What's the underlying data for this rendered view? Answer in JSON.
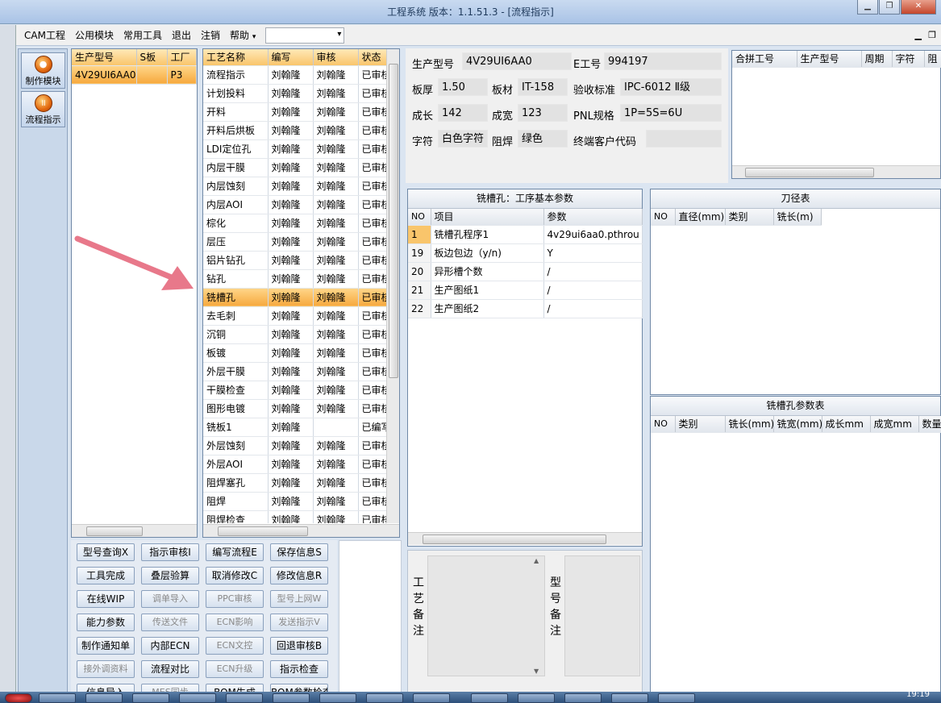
{
  "window": {
    "title": "工程系统    版本：1.1.51.3 - [流程指示]",
    "min": "▁",
    "max": "❐",
    "close": "✕"
  },
  "menu": {
    "items": [
      "CAM工程",
      "公用模块",
      "常用工具",
      "退出",
      "注销",
      "帮助"
    ],
    "help_arrow": "▾",
    "combo_value": "",
    "mdi_min": "▁",
    "mdi_restore": "❐"
  },
  "nav": {
    "items": [
      {
        "label": "制作模块",
        "icon": "flame-icon"
      },
      {
        "label": "流程指示",
        "icon": "pause-icon"
      }
    ]
  },
  "model_list": {
    "headers": [
      "生产型号",
      "S板",
      "工厂"
    ],
    "rows": [
      [
        "4V29UI6AA0",
        "",
        "P3"
      ]
    ]
  },
  "process_list": {
    "headers": [
      "工艺名称",
      "编写",
      "审核",
      "状态"
    ],
    "rows": [
      [
        "流程指示",
        "刘翰隆",
        "刘翰隆",
        "已审核"
      ],
      [
        "计划投料",
        "刘翰隆",
        "刘翰隆",
        "已审核"
      ],
      [
        "开料",
        "刘翰隆",
        "刘翰隆",
        "已审核"
      ],
      [
        "开料后烘板",
        "刘翰隆",
        "刘翰隆",
        "已审核"
      ],
      [
        "LDI定位孔",
        "刘翰隆",
        "刘翰隆",
        "已审核"
      ],
      [
        "内层干膜",
        "刘翰隆",
        "刘翰隆",
        "已审核"
      ],
      [
        "内层蚀刻",
        "刘翰隆",
        "刘翰隆",
        "已审核"
      ],
      [
        "内层AOI",
        "刘翰隆",
        "刘翰隆",
        "已审核"
      ],
      [
        "棕化",
        "刘翰隆",
        "刘翰隆",
        "已审核"
      ],
      [
        "层压",
        "刘翰隆",
        "刘翰隆",
        "已审核"
      ],
      [
        "铝片钻孔",
        "刘翰隆",
        "刘翰隆",
        "已审核"
      ],
      [
        "钻孔",
        "刘翰隆",
        "刘翰隆",
        "已审核"
      ],
      [
        "铣槽孔",
        "刘翰隆",
        "刘翰隆",
        "已审核"
      ],
      [
        "去毛刺",
        "刘翰隆",
        "刘翰隆",
        "已审核"
      ],
      [
        "沉铜",
        "刘翰隆",
        "刘翰隆",
        "已审核"
      ],
      [
        "板镀",
        "刘翰隆",
        "刘翰隆",
        "已审核"
      ],
      [
        "外层干膜",
        "刘翰隆",
        "刘翰隆",
        "已审核"
      ],
      [
        "干膜检查",
        "刘翰隆",
        "刘翰隆",
        "已审核"
      ],
      [
        "图形电镀",
        "刘翰隆",
        "刘翰隆",
        "已审核"
      ],
      [
        "铣板1",
        "刘翰隆",
        "",
        "已编写"
      ],
      [
        "外层蚀刻",
        "刘翰隆",
        "刘翰隆",
        "已审核"
      ],
      [
        "外层AOI",
        "刘翰隆",
        "刘翰隆",
        "已审核"
      ],
      [
        "阻焊塞孔",
        "刘翰隆",
        "刘翰隆",
        "已审核"
      ],
      [
        "阻焊",
        "刘翰隆",
        "刘翰隆",
        "已审核"
      ],
      [
        "阻焊检查",
        "刘翰隆",
        "刘翰隆",
        "已审核"
      ]
    ],
    "selected_index": 12
  },
  "buttons": [
    [
      "型号查询X",
      "指示审核I",
      "编写流程E",
      "保存信息S"
    ],
    [
      "工具完成",
      "叠层验算",
      "取消修改C",
      "修改信息R"
    ],
    [
      "在线WIP",
      "调单导入",
      "PPC审核",
      "型号上网W"
    ],
    [
      "能力参数",
      "传送文件",
      "ECN影响",
      "发送指示V"
    ],
    [
      "制作通知单",
      "内部ECN",
      "ECN文控",
      "回退审核B"
    ],
    [
      "接外调资料",
      "流程对比",
      "ECN升级",
      "指示检查"
    ],
    [
      "信息导入",
      "MES同步",
      "BOM生成",
      "BOM参数检查"
    ]
  ],
  "buttons_disabled": [
    [
      false,
      false,
      false,
      false
    ],
    [
      false,
      false,
      false,
      false
    ],
    [
      false,
      true,
      true,
      true
    ],
    [
      false,
      true,
      true,
      true
    ],
    [
      false,
      false,
      true,
      false
    ],
    [
      true,
      false,
      true,
      false
    ],
    [
      false,
      true,
      false,
      false
    ]
  ],
  "info": {
    "production_model": {
      "label": "生产型号",
      "value": "4V29UI6AA0"
    },
    "e_number": {
      "label": "E工号",
      "value": "994197"
    },
    "thickness": {
      "label": "板厚",
      "value": "1.50"
    },
    "material": {
      "label": "板材",
      "value": "IT-158"
    },
    "acceptance": {
      "label": "验收标准",
      "value": "IPC-6012 Ⅱ级"
    },
    "length": {
      "label": "成长",
      "value": "142"
    },
    "width": {
      "label": "成宽",
      "value": "123"
    },
    "pnl": {
      "label": "PNL规格",
      "value": "1P=5S=6U"
    },
    "legend": {
      "label": "字符",
      "value": "白色字符"
    },
    "soldermask": {
      "label": "阻焊",
      "value": "绿色"
    },
    "customer_code": {
      "label": "终端客户代码",
      "value": ""
    }
  },
  "merge_table": {
    "headers": [
      "合拼工号",
      "生产型号",
      "周期",
      "字符",
      "阻"
    ]
  },
  "params": {
    "title": "铣槽孔：工序基本参数",
    "headers": [
      "NO",
      "项目",
      "参数"
    ],
    "rows": [
      [
        "1",
        "铣槽孔程序1",
        "4v29ui6aa0.pthrou"
      ],
      [
        "19",
        "板边包边（y/n)",
        "Y"
      ],
      [
        "20",
        "异形槽个数",
        "/"
      ],
      [
        "21",
        "生产图纸1",
        "/"
      ],
      [
        "22",
        "生产图纸2",
        "/"
      ]
    ]
  },
  "tool_table": {
    "title": "刀径表",
    "headers": [
      "NO",
      "直径(mm)",
      "类别",
      "铣长(m)"
    ]
  },
  "slot_table": {
    "title": "铣槽孔参数表",
    "headers": [
      "NO",
      "类别",
      "铣长(mm)",
      "铣宽(mm)",
      "成长mm",
      "成宽mm",
      "数量"
    ]
  },
  "remarks": {
    "process_label": "工艺备注",
    "model_label": "型号备注",
    "process_value": "",
    "model_value": ""
  },
  "clock": "19:19",
  "colors": {
    "accent": "#f6a93e",
    "header_orange": "#f9c56b",
    "arrow": "#e8788a"
  }
}
